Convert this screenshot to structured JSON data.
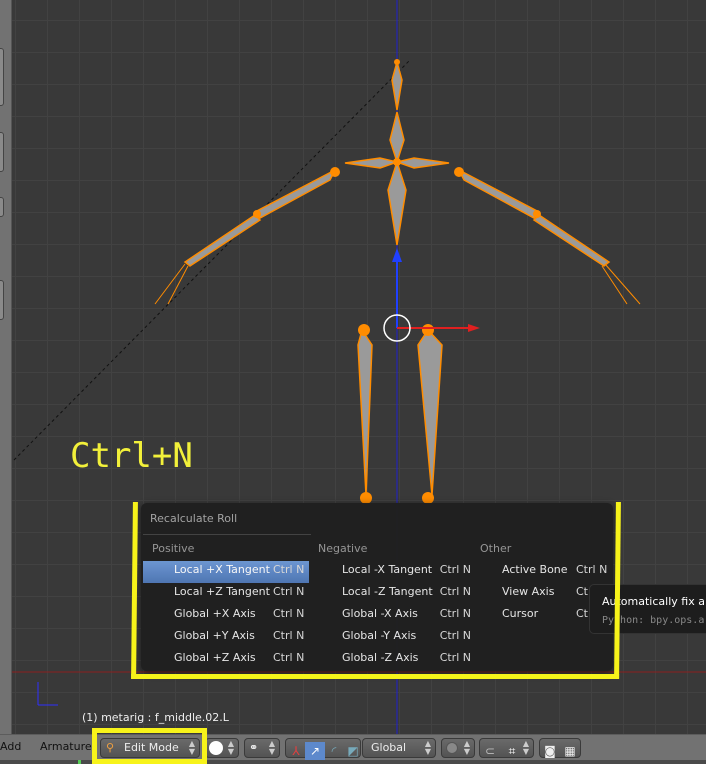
{
  "overlay": {
    "shortcut_text": "Ctrl+N"
  },
  "status": {
    "selection": "(1) metarig : f_middle.02.L"
  },
  "menu": {
    "title": "Recalculate Roll",
    "columns": [
      {
        "header": "Positive",
        "items": [
          {
            "label": "Local +X Tangent",
            "shortcut": "Ctrl N",
            "highlighted": true
          },
          {
            "label": "Local +Z Tangent",
            "shortcut": "Ctrl N"
          },
          {
            "label": "Global +X Axis",
            "shortcut": "Ctrl N"
          },
          {
            "label": "Global +Y Axis",
            "shortcut": "Ctrl N"
          },
          {
            "label": "Global +Z Axis",
            "shortcut": "Ctrl N"
          }
        ]
      },
      {
        "header": "Negative",
        "items": [
          {
            "label": "Local -X Tangent",
            "shortcut": "Ctrl N"
          },
          {
            "label": "Local -Z Tangent",
            "shortcut": "Ctrl N"
          },
          {
            "label": "Global -X Axis",
            "shortcut": "Ctrl N"
          },
          {
            "label": "Global -Y Axis",
            "shortcut": "Ctrl N"
          },
          {
            "label": "Global -Z Axis",
            "shortcut": "Ctrl N"
          }
        ]
      },
      {
        "header": "Other",
        "items": [
          {
            "label": "Active Bone",
            "shortcut": "Ctrl N"
          },
          {
            "label": "View Axis",
            "shortcut": "Ctrl N"
          },
          {
            "label": "Cursor",
            "shortcut": "Ctrl N"
          }
        ]
      }
    ]
  },
  "tooltip": {
    "description": "Automatically fix alig",
    "python": "Python: bpy.ops.ar"
  },
  "header": {
    "menus": [
      "Add",
      "Armature"
    ],
    "mode": "Edit Mode",
    "orientation": "Global",
    "icons": [
      "viewport-shading-icon",
      "pivot-point-icon",
      "manipulator-icon",
      "translate-icon",
      "rotate-icon",
      "scale-icon",
      "proportional-edit-icon",
      "snap-icon",
      "snap-element-icon",
      "render-icon",
      "render-animation-icon"
    ]
  },
  "colors": {
    "highlight": "#f7f31a",
    "bone_outline": "#ff8c00",
    "menu_highlight": "#5d89cc",
    "bone_fill": "#9a9a9a"
  }
}
